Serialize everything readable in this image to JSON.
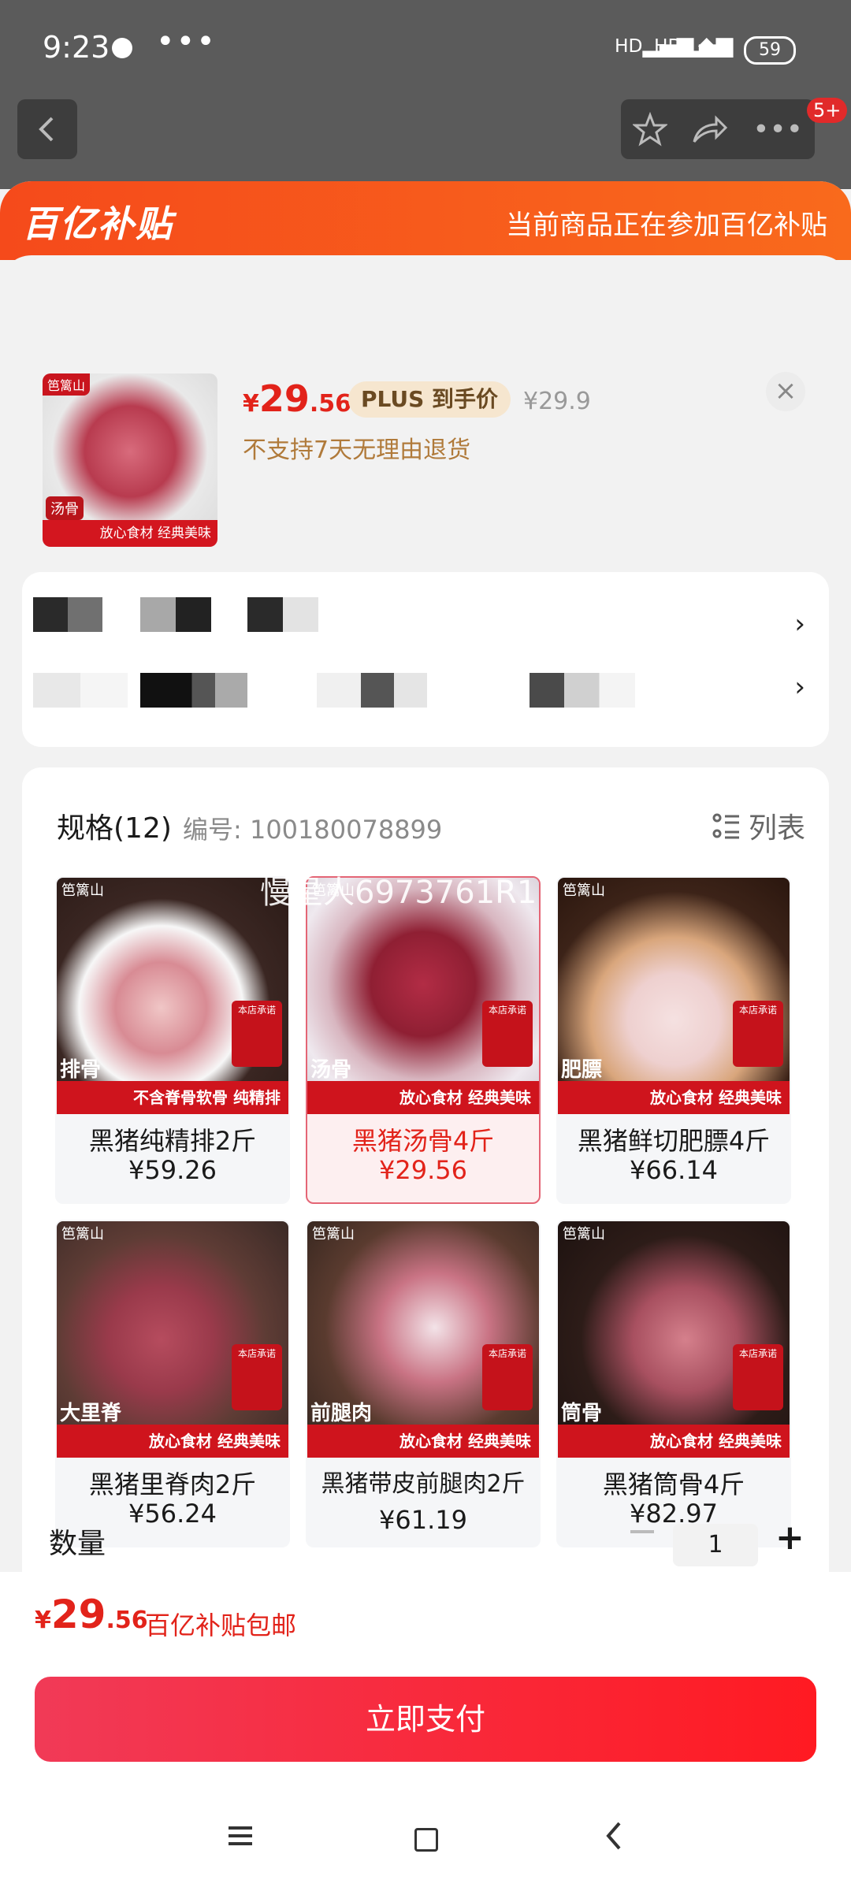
{
  "status_bar": {
    "time": "9:23",
    "dots": "•••",
    "signal1": "HD",
    "signal2": "HD",
    "battery": "59"
  },
  "promo": {
    "logo": "百亿补贴",
    "text": "当前商品正在参加百亿补贴"
  },
  "product": {
    "thumb_brand": "笆篱山",
    "thumb_tag": "汤骨",
    "thumb_banner": "放心食材 经典美味",
    "price_yen": "¥",
    "price_int": "29",
    "price_dec": ".56",
    "plus_label": "PLUS 到手价",
    "original_price": "¥29.9",
    "no_return": "不支持7天无理由退货",
    "close": "×"
  },
  "address": {
    "chevron": "›"
  },
  "spec": {
    "title": "规格(12)",
    "code": "编号: 100180078899",
    "view_label": "列表",
    "items": [
      {
        "brand": "笆篱山",
        "tag": "排骨",
        "banner": "不含脊骨软骨 纯精排",
        "name": "黑猪纯精排2斤",
        "price": "¥59.26"
      },
      {
        "brand": "笆篱山",
        "tag": "汤骨",
        "banner": "放心食材 经典美味",
        "name": "黑猪汤骨4斤",
        "price": "¥29.56"
      },
      {
        "brand": "笆篱山",
        "tag": "肥膘",
        "banner": "放心食材 经典美味",
        "name": "黑猪鲜切肥膘4斤",
        "price": "¥66.14"
      },
      {
        "brand": "笆篱山",
        "tag": "大里脊",
        "banner": "放心食材 经典美味",
        "name": "黑猪里脊肉2斤",
        "price": "¥56.24"
      },
      {
        "brand": "笆篱山",
        "tag": "前腿肉",
        "banner": "放心食材 经典美味",
        "name": "黑猪带皮前腿肉2斤",
        "price": "¥61.19"
      },
      {
        "brand": "笆篱山",
        "tag": "筒骨",
        "banner": "放心食材 经典美味",
        "name": "黑猪筒骨4斤",
        "price": "¥82.97"
      }
    ],
    "promise": "本店承诺"
  },
  "watermark": "慢星人6973761R1",
  "quantity": {
    "label": "数量",
    "value": "1",
    "plus": "+"
  },
  "bottom": {
    "price_yen": "¥",
    "price_int": "29",
    "price_dec": ".56",
    "note": "百亿补贴包邮",
    "pay_label": "立即支付"
  },
  "badge": "5+",
  "colors": {
    "accent_red": "#e2231a",
    "promo_orange": "#f54a1b",
    "pay_button": "#ff1a22"
  }
}
